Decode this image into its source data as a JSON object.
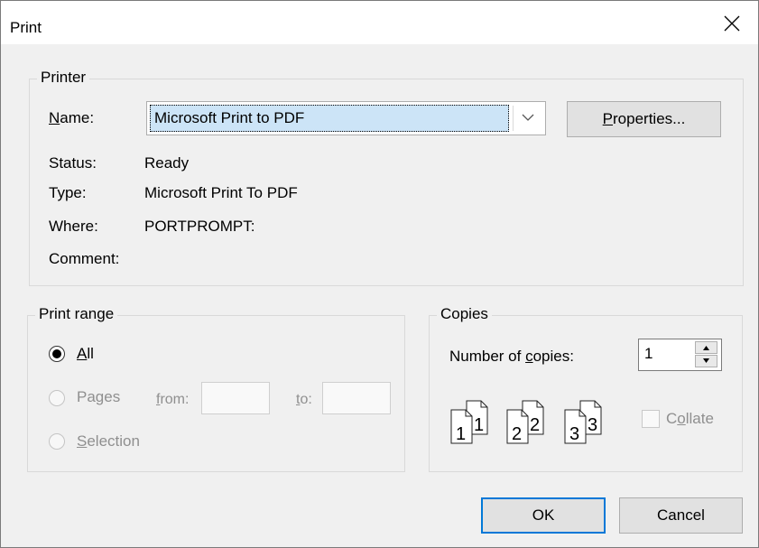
{
  "window": {
    "title": "Print"
  },
  "printer": {
    "group_title": "Printer",
    "name_label": "Name:",
    "name_value": "Microsoft Print to PDF",
    "properties_label": "Properties...",
    "status_label": "Status:",
    "status_value": "Ready",
    "type_label": "Type:",
    "type_value": "Microsoft Print To PDF",
    "where_label": "Where:",
    "where_value": "PORTPROMPT:",
    "comment_label": "Comment:"
  },
  "print_range": {
    "group_title": "Print range",
    "all_label": "All",
    "pages_label": "Pages",
    "from_label": "from:",
    "to_label": "to:",
    "selection_label": "Selection",
    "selected": "All"
  },
  "copies": {
    "group_title": "Copies",
    "number_label": "Number of copies:",
    "number_value": "1",
    "collate_label": "Collate",
    "collate_checked": false,
    "page_icon_numbers": [
      "1",
      "1",
      "2",
      "2",
      "3",
      "3"
    ]
  },
  "buttons": {
    "ok": "OK",
    "cancel": "Cancel"
  },
  "colors": {
    "accent": "#0078d7",
    "selection": "#cce4f7"
  },
  "icons": [
    "close-icon",
    "chevron-down-icon",
    "spin-up-icon",
    "spin-down-icon",
    "collate-pages-icon"
  ]
}
